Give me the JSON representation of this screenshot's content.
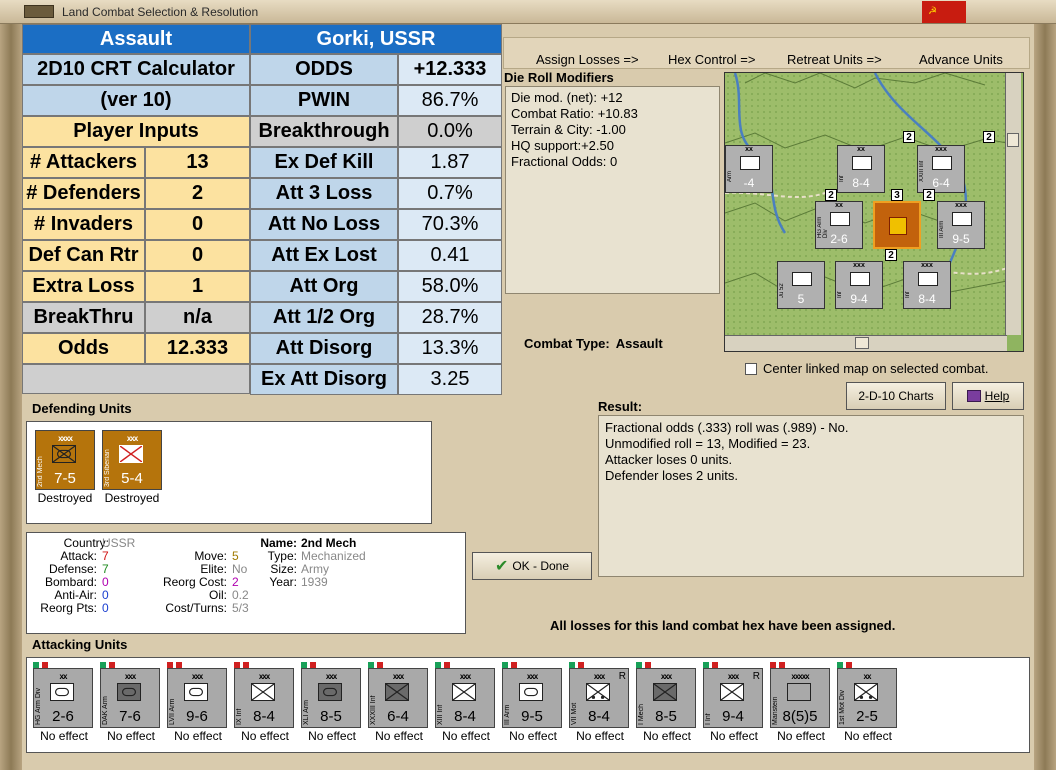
{
  "window": {
    "title": "Land Combat Selection & Resolution"
  },
  "crt": {
    "title_left": "Assault",
    "title_right": "Gorki, USSR",
    "calc_line1": "2D10 CRT Calculator",
    "calc_line2": "(ver 10)",
    "player_inputs": "Player Inputs",
    "inputs": [
      {
        "label": "# Attackers",
        "value": "13"
      },
      {
        "label": "# Defenders",
        "value": "2"
      },
      {
        "label": "# Invaders",
        "value": "0"
      },
      {
        "label": "Def Can Rtr",
        "value": "0"
      },
      {
        "label": "Extra Loss",
        "value": "1"
      },
      {
        "label": "BreakThru",
        "value": "n/a"
      },
      {
        "label": "Odds",
        "value": "12.333"
      }
    ],
    "results": [
      {
        "label": "ODDS",
        "value": "+12.333"
      },
      {
        "label": "PWIN",
        "value": "86.7%"
      },
      {
        "label": "Breakthrough",
        "value": "0.0%"
      },
      {
        "label": "Ex Def Kill",
        "value": "1.87"
      },
      {
        "label": "Att 3 Loss",
        "value": "0.7%"
      },
      {
        "label": "Att No Loss",
        "value": "70.3%"
      },
      {
        "label": "Att Ex Lost",
        "value": "0.41"
      },
      {
        "label": "Att Org",
        "value": "58.0%"
      },
      {
        "label": "Att 1/2 Org",
        "value": "28.7%"
      },
      {
        "label": "Att Disorg",
        "value": "13.3%"
      },
      {
        "label": "Ex Att Disorg",
        "value": "3.25"
      }
    ]
  },
  "menu": {
    "assign": "Assign Losses =>",
    "hex": "Hex Control =>",
    "retreat": "Retreat Units =>",
    "advance": "Advance Units"
  },
  "die": {
    "label": "Die Roll Modifiers",
    "lines": [
      "Die mod. (net): +12",
      "",
      "Combat Ratio: +10.83",
      "Terrain & City: -1.00",
      "HQ support:+2.50",
      "Fractional Odds: 0"
    ]
  },
  "map": {
    "units": [
      {
        "name": "III Arm",
        "fac": "9-5",
        "size": "xxx"
      },
      {
        "name": "XXIII Inf",
        "fac": "6-4",
        "size": "xxx"
      },
      {
        "name": "Inf",
        "fac": "8-4",
        "size": "xx"
      },
      {
        "name": "HG Arm Div",
        "fac": "2-6",
        "size": "xx"
      },
      {
        "name": "Inf",
        "fac": "9-4",
        "size": "xxx"
      },
      {
        "name": "Inf",
        "fac": "8-4",
        "size": "xxx"
      },
      {
        "name": "Ju 52",
        "fac": "5",
        "size": ""
      },
      {
        "name": "Arm",
        "fac": "-4",
        "size": "xx"
      }
    ],
    "stack_counts": [
      "2",
      "2",
      "2",
      "3",
      "2",
      "2"
    ]
  },
  "combat_type": {
    "label": "Combat Type:",
    "value": "Assault"
  },
  "center_option": "Center linked map on selected combat.",
  "buttons": {
    "charts": "2-D-10 Charts",
    "help": "Help",
    "ok": "OK - Done"
  },
  "result": {
    "label": "Result:",
    "lines": [
      "Fractional odds (.333) roll was (.989)  - No.",
      "Unmodified roll = 13, Modified = 23.",
      "Attacker loses 0 units.",
      "Defender loses 2 units."
    ]
  },
  "defenders": {
    "label": "Defending Units",
    "units": [
      {
        "name": "2nd Mech",
        "size": "xxxx",
        "fac": "7-5",
        "status": "Destroyed",
        "type": "mech"
      },
      {
        "name": "3rd Siberian",
        "size": "xxx",
        "fac": "5-4",
        "status": "Destroyed",
        "type": "inf"
      }
    ]
  },
  "info": {
    "country_label": "Country:",
    "country": "USSR",
    "attack_label": "Attack:",
    "attack": "7",
    "defense_label": "Defense:",
    "defense": "7",
    "bombard_label": "Bombard:",
    "bombard": "0",
    "antiair_label": "Anti-Air:",
    "antiair": "0",
    "reorg_label": "Reorg Pts:",
    "reorg": "0",
    "move_label": "Move:",
    "move": "5",
    "elite_label": "Elite:",
    "elite": "No",
    "reorgcost_label": "Reorg Cost:",
    "reorgcost": "2",
    "oil_label": "Oil:",
    "oil": "0.2",
    "costturns_label": "Cost/Turns:",
    "costturns": "5/3",
    "name_label": "Name:",
    "name": "2nd Mech",
    "type_label": "Type:",
    "type": "Mechanized",
    "size_label": "Size:",
    "size": "Army",
    "year_label": "Year:",
    "year": "1939"
  },
  "loss_message": "All losses for this land combat hex have been assigned.",
  "attackers": {
    "label": "Attacking Units",
    "units": [
      {
        "name": "HG Arm Div",
        "size": "xx",
        "fac": "2-6",
        "status": "No effect",
        "type": "arm",
        "dot": "green",
        "r": ""
      },
      {
        "name": "DAK Arm",
        "size": "xxx",
        "fac": "7-6",
        "status": "No effect",
        "type": "armdark",
        "dot": "green",
        "r": ""
      },
      {
        "name": "LVII Arm",
        "size": "xxx",
        "fac": "9-6",
        "status": "No effect",
        "type": "arm",
        "dot": "red",
        "r": ""
      },
      {
        "name": "IX Inf",
        "size": "xxx",
        "fac": "8-4",
        "status": "No effect",
        "type": "inf",
        "dot": "red",
        "r": ""
      },
      {
        "name": "XLI Arm",
        "size": "xxx",
        "fac": "8-5",
        "status": "No effect",
        "type": "armdark",
        "dot": "green",
        "r": ""
      },
      {
        "name": "XXXIII Inf",
        "size": "xxx",
        "fac": "6-4",
        "status": "No effect",
        "type": "infdark",
        "dot": "green",
        "r": ""
      },
      {
        "name": "XIII Inf",
        "size": "xxx",
        "fac": "8-4",
        "status": "No effect",
        "type": "inf",
        "dot": "green",
        "r": ""
      },
      {
        "name": "III Arm",
        "size": "xxx",
        "fac": "9-5",
        "status": "No effect",
        "type": "arm",
        "dot": "green",
        "r": ""
      },
      {
        "name": "VII Mot",
        "size": "xxx",
        "fac": "8-4",
        "status": "No effect",
        "type": "mot",
        "dot": "green",
        "r": "R"
      },
      {
        "name": "I Mech",
        "size": "xxx",
        "fac": "8-5",
        "status": "No effect",
        "type": "infdark",
        "dot": "green",
        "r": ""
      },
      {
        "name": "I Inf",
        "size": "xxx",
        "fac": "9-4",
        "status": "No effect",
        "type": "inf",
        "dot": "green",
        "r": "R"
      },
      {
        "name": "Manstein",
        "size": "xxxxx",
        "fac": "8(5)5",
        "status": "No effect",
        "type": "hq",
        "dot": "red",
        "r": ""
      },
      {
        "name": "1st Mot Div",
        "size": "xx",
        "fac": "2-5",
        "status": "No effect",
        "type": "mot",
        "dot": "green",
        "r": ""
      }
    ]
  },
  "colors": {
    "header_blue": "#1b6ec4",
    "input_yellow": "#fce2a0",
    "soviet_brown": "#b5740c",
    "german_grey": "#a9a9a9"
  }
}
